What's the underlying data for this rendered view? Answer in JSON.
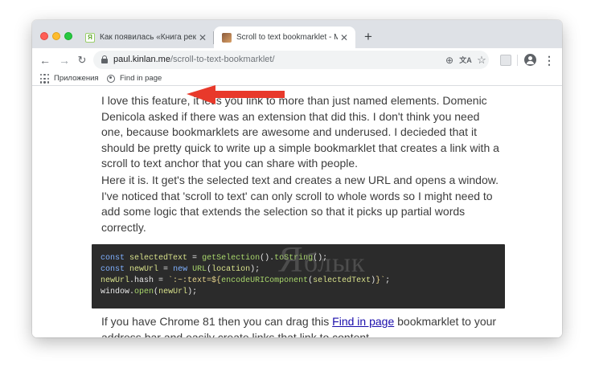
{
  "tabs": [
    {
      "title": "Как появилась «Книга рекорд",
      "favicon": "Я"
    },
    {
      "title": "Scroll to text bookmarklet - Mo"
    }
  ],
  "toolbar": {
    "url_domain": "paul.kinlan.me",
    "url_path": "/scroll-to-text-bookmarklet/"
  },
  "bookmarks": {
    "apps_label": "Приложения",
    "find_label": "Find in page"
  },
  "article": {
    "p1": "I love this feature, it let's you link to more than just named elements. Domenic Denicola asked if there was an extension that did this. I don't think you need one, because bookmarklets are awesome and underused. I decieded that it should be pretty quick to write up a simple bookmarklet that creates a link with a scroll to text anchor that you can share with people.",
    "p2": "Here it is. It get's the selected text and creates a new URL and opens a window. I've noticed that 'scroll to text' can only scroll to whole words so I might need to add some logic that extends the selection so that it picks up partial words correctly.",
    "p3_before": "If you have Chrome 81 then you can drag this ",
    "p3_link": "Find in page",
    "p3_after": " bookmarklet to your address bar and easily create links that link to content."
  },
  "code": {
    "line1": {
      "kw": "const",
      "var": "selectedText",
      "eq": " = ",
      "fn1": "getSelection",
      "mid": "().",
      "fn2": "toString",
      "end": "();"
    },
    "line2": {
      "kw": "const",
      "var": "newUrl",
      "eq": " = ",
      "kw2": "new",
      "fn": "URL",
      "open": "(",
      "arg": "location",
      "end": ");"
    },
    "line3": {
      "obj": "newUrl",
      "prop": ".hash",
      "eq": " = ",
      "str1": "`:~:text=${",
      "fn": "encodeURIComponent",
      "open": "(",
      "arg": "selectedText",
      "close": ")",
      "str2": "}`",
      "end": ";"
    },
    "line4": {
      "obj": "window",
      "dot": ".",
      "fn": "open",
      "open": "(",
      "arg": "newUrl",
      "end": ");"
    }
  },
  "watermark": {
    "big": "Я",
    "rest": "блык"
  },
  "colors": {
    "arrow": "#e8392b",
    "link": "#1a0dab",
    "code_bg": "#2b2b2b"
  }
}
